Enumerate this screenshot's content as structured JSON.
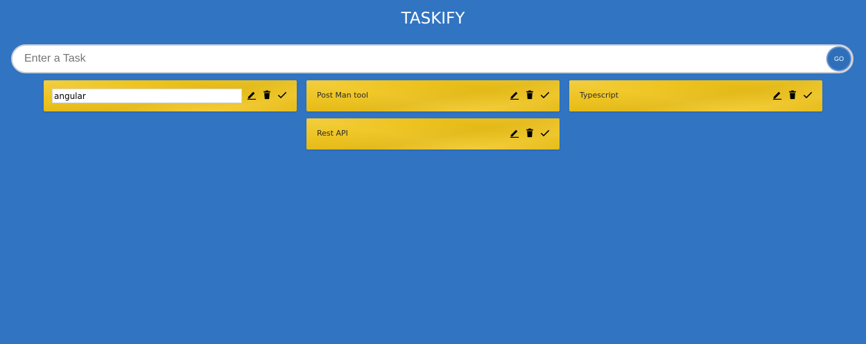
{
  "app": {
    "title": "TASKIFY"
  },
  "input": {
    "placeholder": "Enter a Task",
    "value": "",
    "go_label": "GO"
  },
  "columns": [
    {
      "cards": [
        {
          "text": "angular",
          "editing": true
        }
      ]
    },
    {
      "cards": [
        {
          "text": "Post Man tool",
          "editing": false
        },
        {
          "text": "Rest API",
          "editing": false
        }
      ]
    },
    {
      "cards": [
        {
          "text": "Typescript",
          "editing": false
        }
      ]
    }
  ],
  "icons": {
    "edit": "pencil-icon",
    "delete": "trash-icon",
    "done": "check-icon"
  },
  "colors": {
    "background": "#3174c2",
    "card": "#f0c419",
    "go_button": "#2f6fba"
  }
}
